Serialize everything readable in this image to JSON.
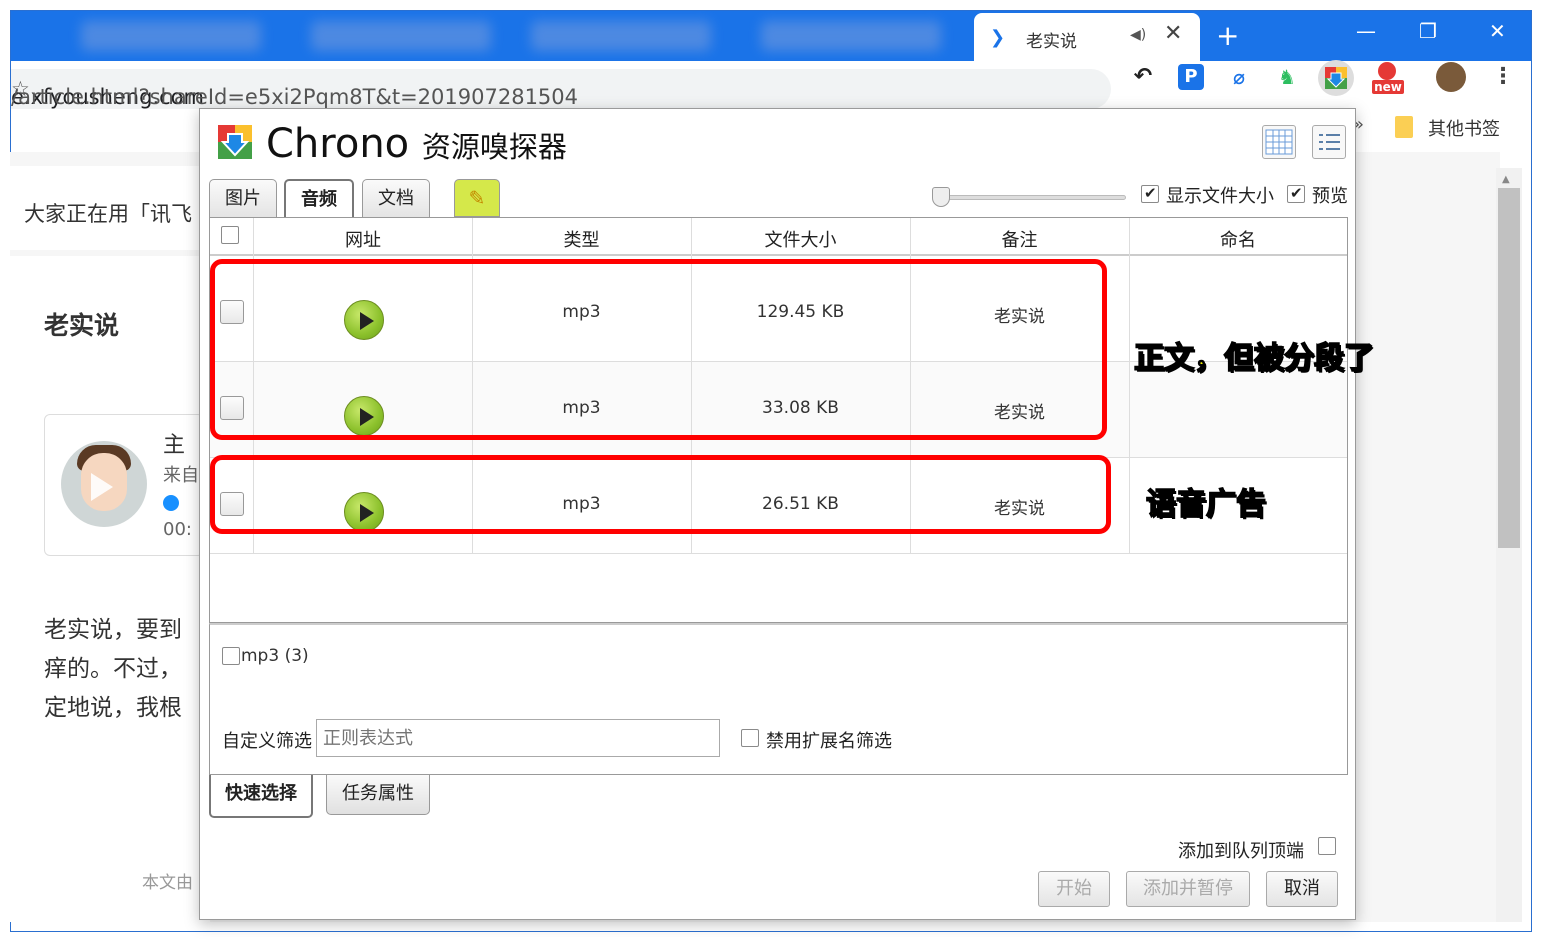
{
  "browser": {
    "active_tab_title": "老实说",
    "address_host": "e.xfyousheng.com",
    "address_path": "/article.html?shareId=e5xi2Pqm8T&t=201907281504",
    "bookmarks_more": "»",
    "bookmark_folder": "其他书签",
    "new_badge": "new"
  },
  "page": {
    "header_text": "大家正在用「讯飞",
    "article_title": "老实说",
    "card_line1": "主",
    "card_line2": "来自",
    "card_line3": "00:",
    "para1": "老实说，要到",
    "para2": "痒的。不过，",
    "para3": "定地说，我根",
    "footer": "本文由"
  },
  "dialog": {
    "app_name": "Chrono",
    "app_subtitle": "资源嗅探器",
    "tabs": [
      "图片",
      "音频",
      "文档"
    ],
    "active_tab": "音频",
    "show_size_label": "显示文件大小",
    "preview_label": "预览",
    "columns": [
      "网址",
      "类型",
      "文件大小",
      "备注",
      "命名"
    ],
    "rows": [
      {
        "type": "mp3",
        "size": "129.45 KB",
        "note": "老实说"
      },
      {
        "type": "mp3",
        "size": "33.08 KB",
        "note": "老实说"
      },
      {
        "type": "mp3",
        "size": "26.51 KB",
        "note": "老实说"
      }
    ],
    "annotations": {
      "body_split": "正文，但被分段了",
      "voice_ad": "语音广告"
    },
    "filter_mp3": "mp3 (3)",
    "custom_filter_label": "自定义筛选",
    "regex_placeholder": "正则表达式",
    "disable_ext_filter": "禁用扩展名筛选",
    "bottom_tabs": [
      "快速选择",
      "任务属性"
    ],
    "add_to_top_label": "添加到队列顶端",
    "buttons": {
      "start": "开始",
      "add_pause": "添加并暂停",
      "cancel": "取消"
    }
  },
  "colors": {
    "accent": "#1a73e8",
    "annotation_box": "#ff0000",
    "annotation_text": "#ffff00"
  }
}
